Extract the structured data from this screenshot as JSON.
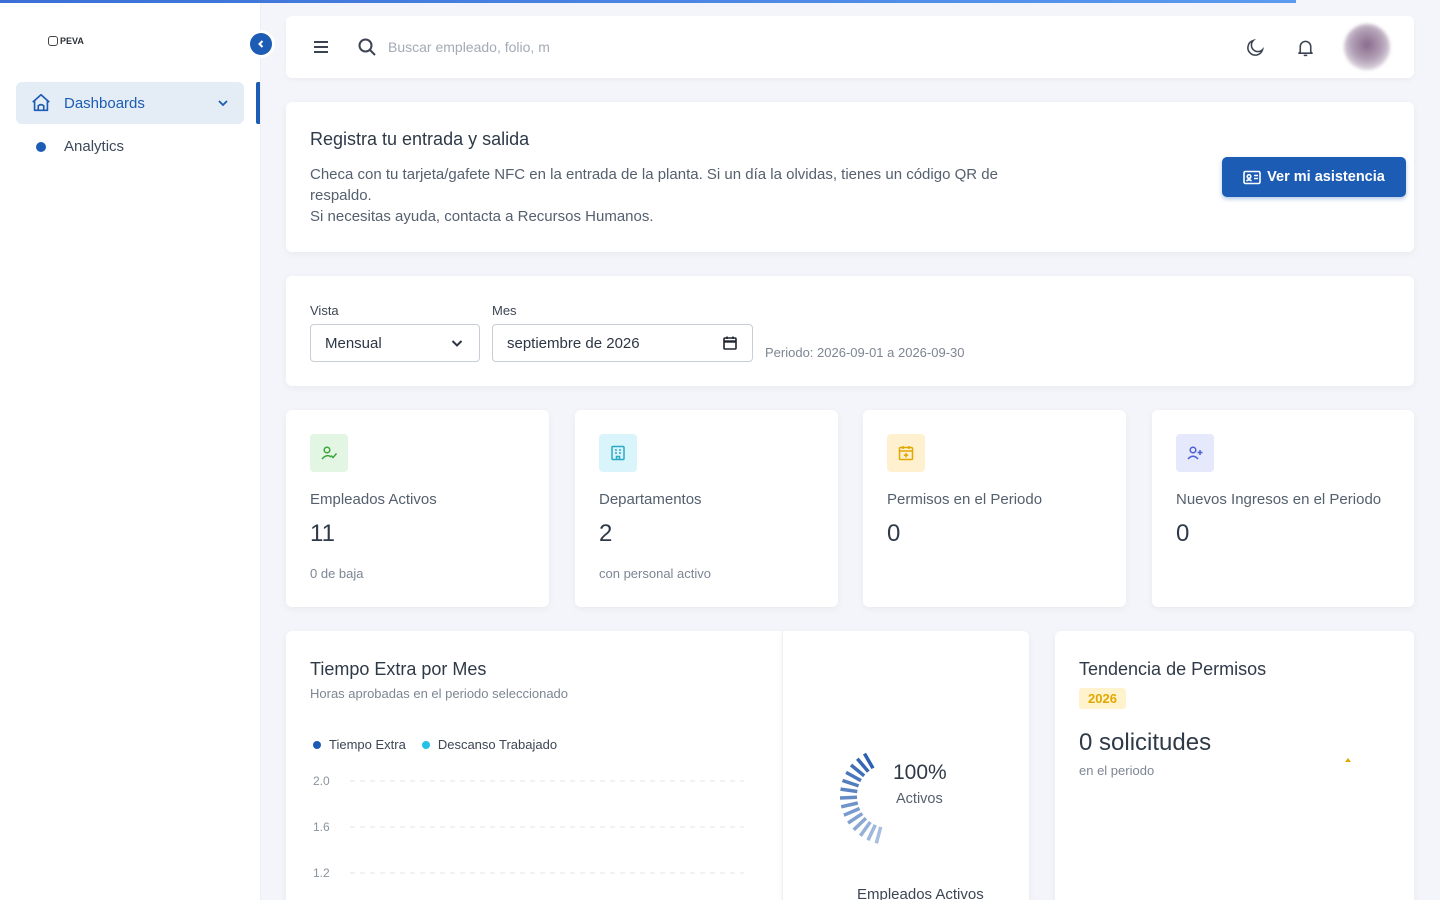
{
  "sidebar": {
    "brand": "PEVA",
    "menu": {
      "label": "Dashboards"
    },
    "items": [
      {
        "label": "Analytics"
      }
    ]
  },
  "search": {
    "placeholder": "Buscar empleado, folio, m"
  },
  "welcome": {
    "title": "Registra tu entrada y salida",
    "line1": "Checa con tu tarjeta/gafete NFC en la entrada de la planta. Si un día la olvidas, tienes un código QR de respaldo.",
    "line2": "Si necesitas ayuda, contacta a Recursos Humanos.",
    "button": "Ver mi asistencia"
  },
  "filters": {
    "view_label": "Vista",
    "view_value": "Mensual",
    "month_label": "Mes",
    "month_value": "septiembre de 2026",
    "period": "Periodo: 2026-09-01 a 2026-09-30"
  },
  "stats": [
    {
      "title": "Empleados Activos",
      "value": "11",
      "sub": "0 de baja",
      "icon": "user-check-icon",
      "color": "#3ca53c",
      "bg": "#e3f5e3"
    },
    {
      "title": "Departamentos",
      "value": "2",
      "sub": "con personal activo",
      "icon": "building-icon",
      "color": "#2aa9c6",
      "bg": "#d9f4fa"
    },
    {
      "title": "Permisos en el Periodo",
      "value": "0",
      "sub": "",
      "icon": "calendar-plus-icon",
      "color": "#e0a800",
      "bg": "#fff1d0"
    },
    {
      "title": "Nuevos Ingresos en el Periodo",
      "value": "0",
      "sub": "",
      "icon": "user-plus-icon",
      "color": "#4b5fd6",
      "bg": "#e6e8fb"
    }
  ],
  "overtime": {
    "title": "Tiempo Extra por Mes",
    "subtitle": "Horas aprobadas en el periodo seleccionado"
  },
  "chart_data": {
    "type": "line",
    "title": "Tiempo Extra por Mes",
    "series": [
      {
        "name": "Tiempo Extra",
        "color": "#1c5cb4",
        "values": []
      },
      {
        "name": "Descanso Trabajado",
        "color": "#22c1e6",
        "values": []
      }
    ],
    "y_ticks": [
      "2.0",
      "1.6",
      "1.2"
    ],
    "grid": true,
    "legend": "top-left"
  },
  "gauge": {
    "percent": "100%",
    "label": "Activos",
    "footer": "Empleados Activos",
    "value": 1.0
  },
  "trend": {
    "title": "Tendencia de Permisos",
    "year": "2026",
    "count": "0 solicitudes",
    "sub": "en el periodo"
  }
}
